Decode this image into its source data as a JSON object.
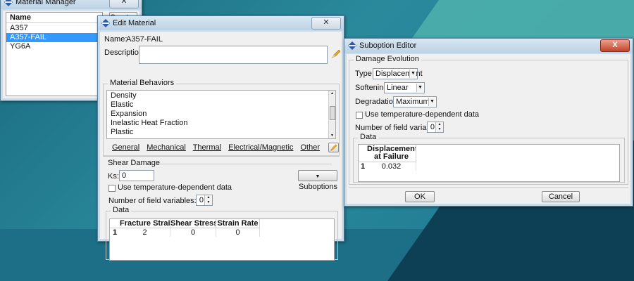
{
  "material_manager": {
    "title": "Material Manager",
    "header": "Name",
    "create_label": "Create...",
    "items": [
      "A357",
      "A357-FAIL",
      "YG6A"
    ],
    "selected_index": 1
  },
  "edit_material": {
    "title": "Edit Material",
    "name_label": "Name:",
    "name_value": "A357-FAIL",
    "description_label": "Description:",
    "description_value": "",
    "behaviors_title": "Material Behaviors",
    "behaviors": [
      "Density",
      "Elastic",
      "Expansion",
      "Inelastic Heat Fraction",
      "Plastic"
    ],
    "menu_tabs": [
      "General",
      "Mechanical",
      "Thermal",
      "Electrical/Magnetic",
      "Other"
    ],
    "shear_title": "Shear Damage",
    "ks_label": "Ks:",
    "ks_value": "0",
    "suboptions_label": "Suboptions",
    "temp_dep_label": "Use temperature-dependent data",
    "field_vars_label": "Number of field variables:",
    "field_vars_value": "0",
    "data_title": "Data",
    "table_headers": [
      "Fracture Strain",
      "Shear Stress Ratio",
      "Strain Rate"
    ],
    "table_rows": [
      {
        "index": "1",
        "values": [
          "2",
          "0",
          "0"
        ]
      }
    ]
  },
  "suboption_editor": {
    "title": "Suboption Editor",
    "group_title": "Damage Evolution",
    "type_label": "Type:",
    "type_value": "Displacement",
    "softening_label": "Softening:",
    "softening_value": "Linear",
    "degradation_label": "Degradation:",
    "degradation_value": "Maximum",
    "temp_dep_label": "Use temperature-dependent data",
    "field_vars_label": "Number of field variables:",
    "field_vars_value": "0",
    "data_title": "Data",
    "table_header_line1": "Displacement",
    "table_header_line2": "at Failure",
    "table_rows": [
      {
        "index": "1",
        "values": [
          "0.032"
        ]
      }
    ],
    "ok_label": "OK",
    "cancel_label": "Cancel",
    "close_label": "X"
  },
  "colors": {
    "desktop": "#1c6f86",
    "title_gradient_top": "#d9e7f2",
    "selection": "#3399ff",
    "close_red": "#c4442a"
  },
  "icons": {
    "window_icon": "abaqus-diamond-icon",
    "description_edit": "pencil-icon",
    "behavior_edit": "pencil-icon",
    "suboptions_arrow": "triangle-down-icon"
  }
}
